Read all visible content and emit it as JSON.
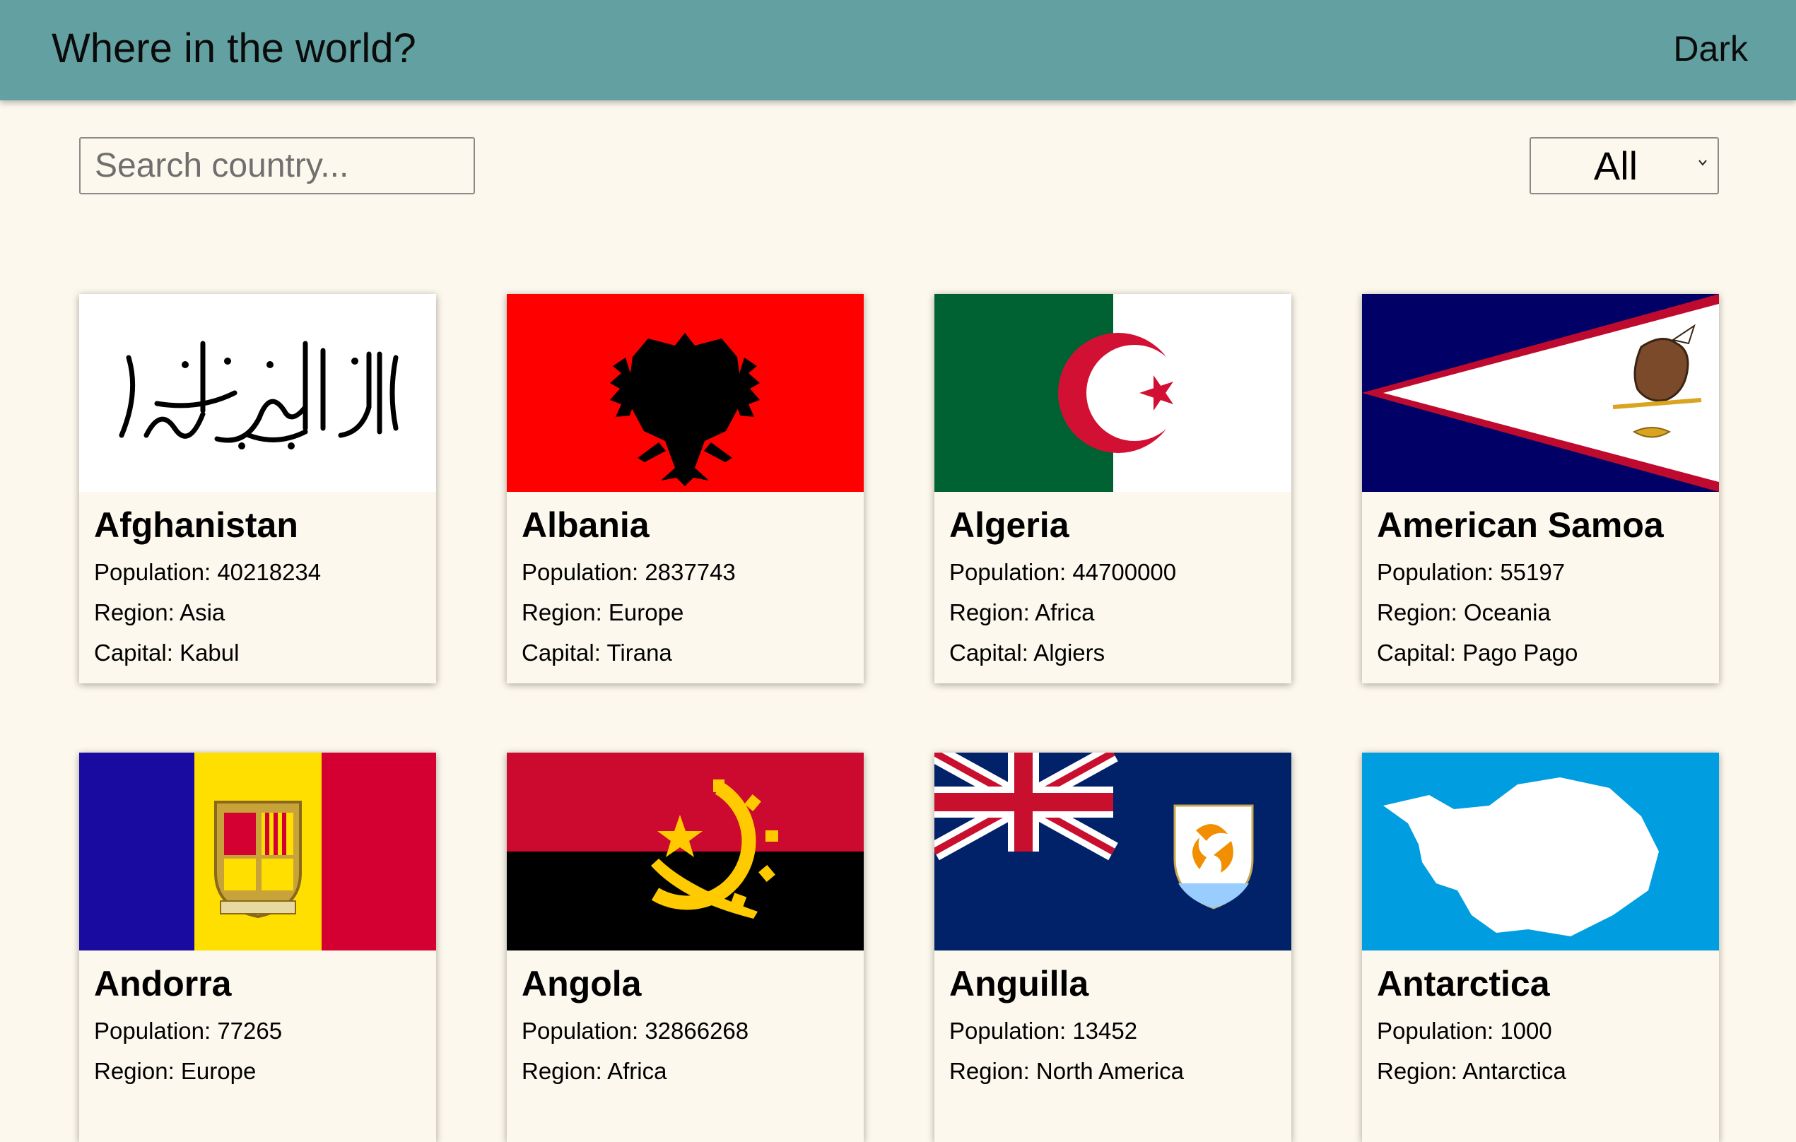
{
  "header": {
    "title": "Where in the world?",
    "theme_toggle": "Dark"
  },
  "filters": {
    "search_placeholder": "Search country...",
    "region_selected": "All"
  },
  "labels": {
    "population": "Population: ",
    "region": "Region: ",
    "capital": "Capital: "
  },
  "countries": [
    {
      "name": "Afghanistan",
      "population": "40218234",
      "region": "Asia",
      "capital": "Kabul",
      "flag_icon": "afghanistan-flag-icon"
    },
    {
      "name": "Albania",
      "population": "2837743",
      "region": "Europe",
      "capital": "Tirana",
      "flag_icon": "albania-flag-icon"
    },
    {
      "name": "Algeria",
      "population": "44700000",
      "region": "Africa",
      "capital": "Algiers",
      "flag_icon": "algeria-flag-icon"
    },
    {
      "name": "American Samoa",
      "population": "55197",
      "region": "Oceania",
      "capital": "Pago Pago",
      "flag_icon": "american-samoa-flag-icon"
    },
    {
      "name": "Andorra",
      "population": "77265",
      "region": "Europe",
      "flag_icon": "andorra-flag-icon"
    },
    {
      "name": "Angola",
      "population": "32866268",
      "region": "Africa",
      "flag_icon": "angola-flag-icon"
    },
    {
      "name": "Anguilla",
      "population": "13452",
      "region": "North America",
      "flag_icon": "anguilla-flag-icon"
    },
    {
      "name": "Antarctica",
      "population": "1000",
      "region": "Antarctica",
      "flag_icon": "antarctica-flag-icon"
    }
  ],
  "colors": {
    "header_bg": "#62a0a1",
    "page_bg": "#fdf8ed",
    "card_bg": "#fdf8ed"
  }
}
